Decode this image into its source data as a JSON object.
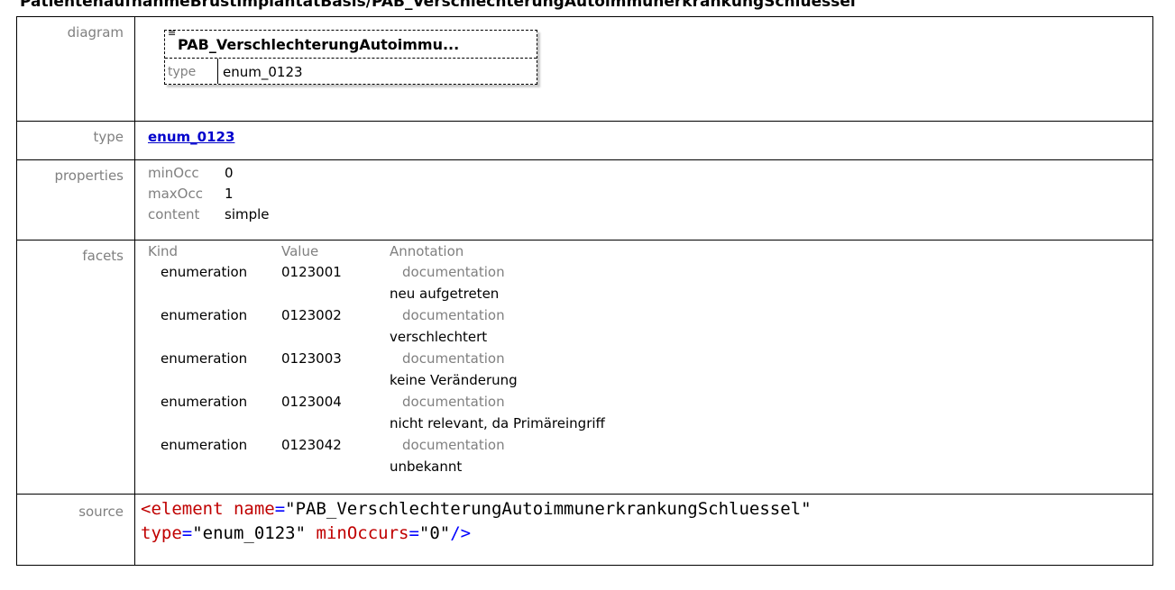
{
  "heading": "PatientenaufnahmeBrustimplantatBasis/PAB_VerschlechterungAutoimmunerkrankungSchluessel",
  "labels": {
    "diagram": "diagram",
    "type": "type",
    "properties": "properties",
    "facets": "facets",
    "source": "source"
  },
  "diagram": {
    "icon": "≡",
    "name": "PAB_VerschlechterungAutoimmu...",
    "type_label": "type",
    "type_value": "enum_0123"
  },
  "type": {
    "link": "enum_0123"
  },
  "properties": [
    {
      "key": "minOcc",
      "value": "0"
    },
    {
      "key": "maxOcc",
      "value": "1"
    },
    {
      "key": "content",
      "value": "simple"
    }
  ],
  "facets": {
    "headers": {
      "kind": "Kind",
      "value": "Value",
      "annotation": "Annotation"
    },
    "rows": [
      {
        "kind": "enumeration",
        "value": "0123001",
        "annotation": "documentation",
        "text": "neu aufgetreten"
      },
      {
        "kind": "enumeration",
        "value": "0123002",
        "annotation": "documentation",
        "text": "verschlechtert"
      },
      {
        "kind": "enumeration",
        "value": "0123003",
        "annotation": "documentation",
        "text": "keine Veränderung"
      },
      {
        "kind": "enumeration",
        "value": "0123004",
        "annotation": "documentation",
        "text": "nicht relevant, da Primäreingriff"
      },
      {
        "kind": "enumeration",
        "value": "0123042",
        "annotation": "documentation",
        "text": "unbekannt"
      }
    ]
  },
  "source": {
    "line1": {
      "open": "<element",
      "attr1": " name",
      "eq": "=",
      "val1": "\"PAB_VerschlechterungAutoimmunerkrankungSchluessel\""
    },
    "line2": {
      "attr2": "type",
      "val2": "\"enum_0123\"",
      "attr3": " minOccurs",
      "val3": "\"0\"",
      "close": "/>"
    }
  },
  "colors": {
    "label_gray": "#808080",
    "link_blue": "#0000cc",
    "xml_tag_red": "#c00000",
    "xml_quote_blue": "#0000ff"
  }
}
